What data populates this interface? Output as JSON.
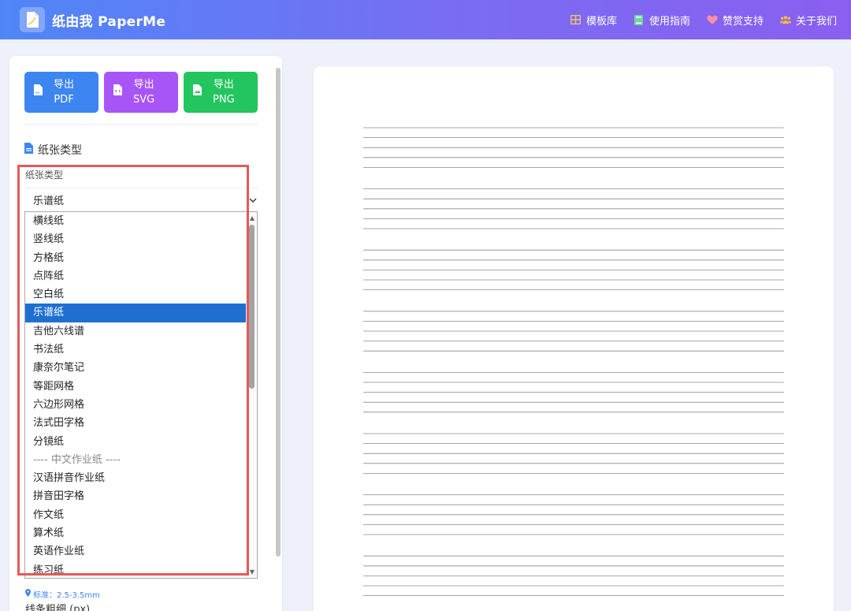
{
  "app": {
    "title": "纸由我 PaperMe"
  },
  "nav": [
    {
      "label": "模板库",
      "icon": "grid-icon",
      "color": "#f4c46b"
    },
    {
      "label": "使用指南",
      "icon": "book-icon",
      "color": "#6fd6a0"
    },
    {
      "label": "赞赏支持",
      "icon": "heart-icon",
      "color": "#ff8fa3"
    },
    {
      "label": "关于我们",
      "icon": "users-icon",
      "color": "#f6b94a"
    }
  ],
  "export": {
    "pdf": "导出\nPDF",
    "svg": "导出\nSVG",
    "png": "导出\nPNG",
    "pdf_line1": "导出",
    "pdf_line2": "PDF",
    "svg_line1": "导出",
    "svg_line2": "SVG",
    "png_line1": "导出",
    "png_line2": "PNG"
  },
  "paper_section": {
    "title": "纸张类型",
    "field_label": "纸张类型",
    "selected_value": "乐谱纸"
  },
  "dropdown": {
    "options": [
      {
        "label": "横线纸"
      },
      {
        "label": "竖线纸"
      },
      {
        "label": "方格纸"
      },
      {
        "label": "点阵纸"
      },
      {
        "label": "空白纸"
      },
      {
        "label": "乐谱纸",
        "selected": true
      },
      {
        "label": "吉他六线谱"
      },
      {
        "label": "书法纸"
      },
      {
        "label": "康奈尔笔记"
      },
      {
        "label": "等距网格"
      },
      {
        "label": "六边形网格"
      },
      {
        "label": "法式田字格"
      },
      {
        "label": "分镜纸"
      },
      {
        "label": "---- 中文作业纸 ----",
        "group": true
      },
      {
        "label": "汉语拼音作业纸"
      },
      {
        "label": "拼音田字格"
      },
      {
        "label": "作文纸"
      },
      {
        "label": "算术纸"
      },
      {
        "label": "英语作业纸"
      },
      {
        "label": "练习纸"
      }
    ]
  },
  "hints": {
    "standard": "标准：2.5-3.5mm",
    "line_weight_label": "线条粗细 (px)"
  },
  "preview": {
    "type": "staff",
    "staff_count": 8,
    "lines_per_staff": 5
  },
  "colors": {
    "accent": "#3d85f0",
    "selected": "#1f6fd1",
    "highlight": "#e45a5a",
    "pdf": "#3d85f0",
    "svg": "#a855f7",
    "png": "#22c55e"
  }
}
